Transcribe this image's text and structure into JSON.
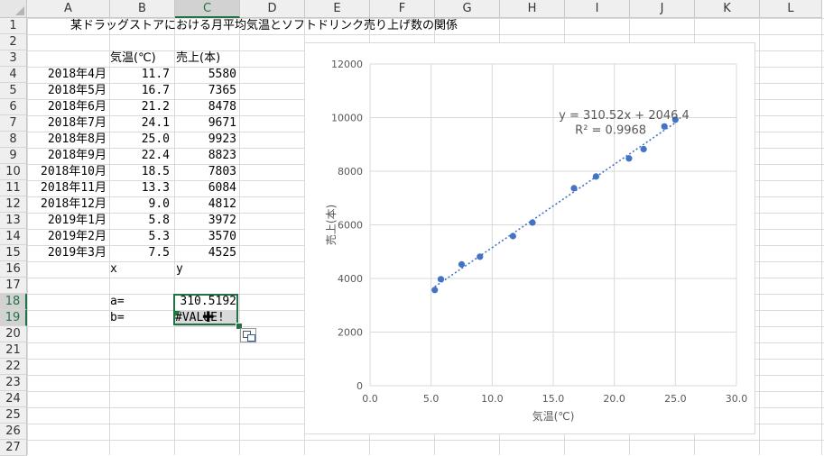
{
  "columns": [
    "A",
    "B",
    "C",
    "D",
    "E",
    "F",
    "G",
    "H",
    "I",
    "J",
    "K",
    "L"
  ],
  "rows": [
    "1",
    "2",
    "3",
    "4",
    "5",
    "6",
    "7",
    "8",
    "9",
    "10",
    "11",
    "12",
    "13",
    "14",
    "15",
    "16",
    "17",
    "18",
    "19",
    "20",
    "21",
    "22",
    "23",
    "24",
    "25",
    "26",
    "27"
  ],
  "selected_column": "C",
  "selected_rows": [
    "18",
    "19"
  ],
  "title": "某ドラッグストアにおける月平均気温とソフトドリンク売り上げ数の関係",
  "header_temp": "気温(℃)",
  "header_sales": "売上(本)",
  "data_rows": [
    {
      "month": "2018年4月",
      "temp": "11.7",
      "sales": "5580"
    },
    {
      "month": "2018年5月",
      "temp": "16.7",
      "sales": "7365"
    },
    {
      "month": "2018年6月",
      "temp": "21.2",
      "sales": "8478"
    },
    {
      "month": "2018年7月",
      "temp": "24.1",
      "sales": "9671"
    },
    {
      "month": "2018年8月",
      "temp": "25.0",
      "sales": "9923"
    },
    {
      "month": "2018年9月",
      "temp": "22.4",
      "sales": "8823"
    },
    {
      "month": "2018年10月",
      "temp": "18.5",
      "sales": "7803"
    },
    {
      "month": "2018年11月",
      "temp": "13.3",
      "sales": "6084"
    },
    {
      "month": "2018年12月",
      "temp": "9.0",
      "sales": "4812"
    },
    {
      "month": "2019年1月",
      "temp": "5.8",
      "sales": "3972"
    },
    {
      "month": "2019年2月",
      "temp": "5.3",
      "sales": "3570"
    },
    {
      "month": "2019年3月",
      "temp": "7.5",
      "sales": "4525"
    }
  ],
  "label_x": "x",
  "label_y": "y",
  "label_a": "a=",
  "label_b": "b=",
  "value_a": "310.5192",
  "value_b": "#VALUE!",
  "colors": {
    "accent": "#217346",
    "marker": "#4472c4",
    "trendline": "#4472c4"
  },
  "chart_data": {
    "type": "scatter",
    "xlabel": "気温(℃)",
    "ylabel": "売上(本)",
    "xlim": [
      0,
      30
    ],
    "ylim": [
      0,
      12000
    ],
    "x_ticks": [
      "0.0",
      "5.0",
      "10.0",
      "15.0",
      "20.0",
      "25.0",
      "30.0"
    ],
    "y_ticks": [
      "0",
      "2000",
      "4000",
      "6000",
      "8000",
      "10000",
      "12000"
    ],
    "grid": true,
    "trendline": {
      "equation": "y = 310.52x + 2046.4",
      "r2": "R² = 0.9968",
      "slope": 310.52,
      "intercept": 2046.4,
      "style": "dotted"
    },
    "x": [
      11.7,
      16.7,
      21.2,
      24.1,
      25.0,
      22.4,
      18.5,
      13.3,
      9.0,
      5.8,
      5.3,
      7.5
    ],
    "y": [
      5580,
      7365,
      8478,
      9671,
      9923,
      8823,
      7803,
      6084,
      4812,
      3972,
      3570,
      4525
    ]
  }
}
